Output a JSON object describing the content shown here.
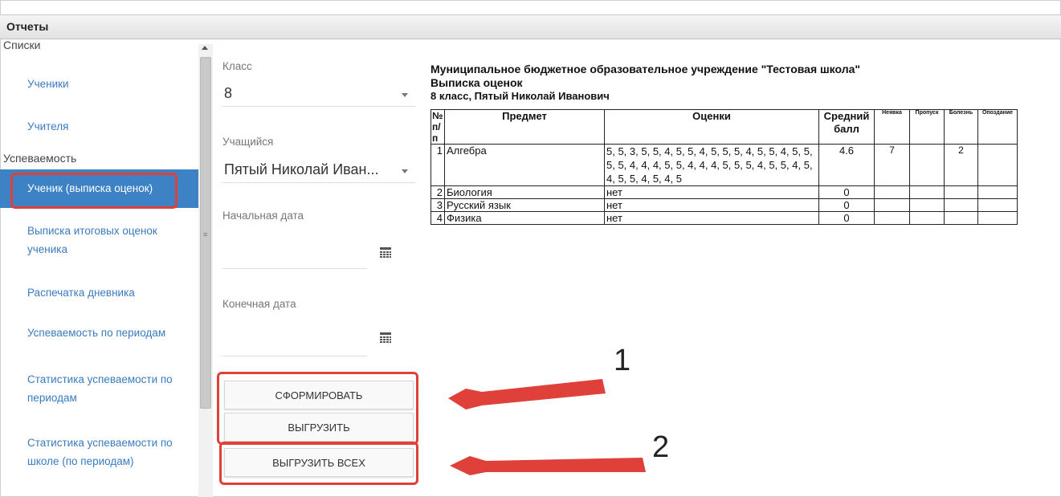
{
  "window": {
    "title": "Отчеты"
  },
  "sidebar": {
    "sections": [
      "Списки",
      "Успеваемость"
    ],
    "items": [
      {
        "label": "Ученики"
      },
      {
        "label": "Учителя"
      },
      {
        "label": "Ученик (выписка оценок)"
      },
      {
        "label": "Выписка итоговых оценок ученика"
      },
      {
        "label": "Распечатка дневника"
      },
      {
        "label": "Успеваемость по периодам"
      },
      {
        "label": "Статистика успеваемости по периодам"
      },
      {
        "label": "Статистика успеваемости по школе (по периодам)"
      }
    ]
  },
  "form": {
    "class_label": "Класс",
    "class_value": "8",
    "student_label": "Учащийся",
    "student_value": "Пятый Николай Иван...",
    "start_label": "Начальная дата",
    "start_value": "",
    "end_label": "Конечная дата",
    "end_value": ""
  },
  "buttons": {
    "generate": "СФОРМИРОВАТЬ",
    "export": "ВЫГРУЗИТЬ",
    "export_all": "ВЫГРУЗИТЬ ВСЕХ"
  },
  "annotations": {
    "one": "1",
    "two": "2"
  },
  "report": {
    "title": "Муниципальное бюджетное образовательное учреждение \"Тестовая школа\"",
    "subtitle": "Выписка оценок",
    "class_student": "8 класс, Пятый Николай Иванович",
    "columns": [
      "№ п/п",
      "Предмет",
      "Оценки",
      "Средний балл",
      "Неявка",
      "Пропуск",
      "Болезнь",
      "Опоздание"
    ],
    "rows": [
      {
        "n": "1",
        "subject": "Алгебра",
        "grades": "5, 5, 3, 5, 5, 4, 5, 5, 4, 5, 5, 5, 4, 5, 5, 4, 5, 5, 5, 5, 4, 4, 4, 5, 5, 4, 4, 4, 5, 5, 5, 4, 5, 5, 4, 5, 4, 5, 5, 4, 5, 4, 5",
        "avg": "4.6",
        "absent": "7",
        "skip": "",
        "ill": "2",
        "late": ""
      },
      {
        "n": "2",
        "subject": "Биология",
        "grades": "нет",
        "avg": "0",
        "absent": "",
        "skip": "",
        "ill": "",
        "late": ""
      },
      {
        "n": "3",
        "subject": "Русский язык",
        "grades": "нет",
        "avg": "0",
        "absent": "",
        "skip": "",
        "ill": "",
        "late": ""
      },
      {
        "n": "4",
        "subject": "Физика",
        "grades": "нет",
        "avg": "0",
        "absent": "",
        "skip": "",
        "ill": "",
        "late": ""
      }
    ]
  },
  "colors": {
    "accent": "#3d82c4",
    "highlight": "#e0403a",
    "link": "#3a7bc0"
  },
  "icons": [
    "calendar-icon",
    "chevron-down-icon",
    "arrow-annotation-icon"
  ]
}
